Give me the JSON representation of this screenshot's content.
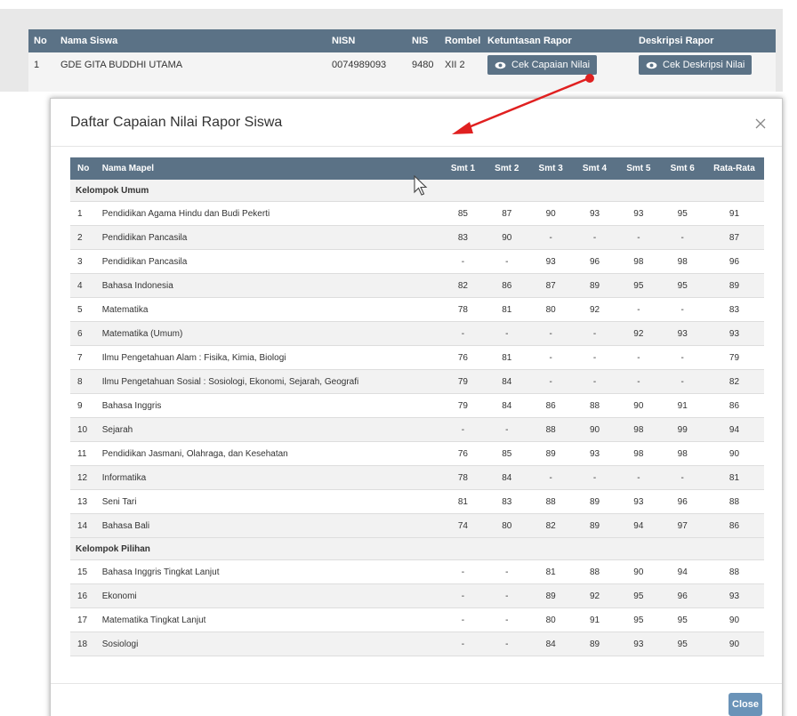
{
  "background": {
    "headers": [
      "No",
      "Nama Siswa",
      "NISN",
      "NIS",
      "Rombel",
      "Ketuntasan Rapor",
      "Deskripsi Rapor"
    ],
    "row": {
      "no": "1",
      "nama": "GDE GITA BUDDHI UTAMA",
      "nisn": "0074989093",
      "nis": "9480",
      "rombel": "XII 2",
      "cek_capaian": "Cek Capaian Nilai",
      "cek_deskripsi": "Cek Deskripsi Nilai"
    }
  },
  "modal": {
    "title": "Daftar Capaian Nilai Rapor Siswa",
    "close_label": "Close",
    "headers": {
      "no": "No",
      "mapel": "Nama Mapel",
      "smt1": "Smt 1",
      "smt2": "Smt 2",
      "smt3": "Smt 3",
      "smt4": "Smt 4",
      "smt5": "Smt 5",
      "smt6": "Smt 6",
      "rata": "Rata-Rata"
    },
    "group_umum": "Kelompok Umum",
    "group_pilihan": "Kelompok Pilihan",
    "rows_umum": [
      {
        "no": "1",
        "mapel": "Pendidikan Agama Hindu dan Budi Pekerti",
        "s": [
          "85",
          "87",
          "90",
          "93",
          "93",
          "95"
        ],
        "rata": "91"
      },
      {
        "no": "2",
        "mapel": "Pendidikan Pancasila",
        "s": [
          "83",
          "90",
          "-",
          "-",
          "-",
          "-"
        ],
        "rata": "87"
      },
      {
        "no": "3",
        "mapel": "Pendidikan Pancasila",
        "s": [
          "-",
          "-",
          "93",
          "96",
          "98",
          "98"
        ],
        "rata": "96"
      },
      {
        "no": "4",
        "mapel": "Bahasa Indonesia",
        "s": [
          "82",
          "86",
          "87",
          "89",
          "95",
          "95"
        ],
        "rata": "89"
      },
      {
        "no": "5",
        "mapel": "Matematika",
        "s": [
          "78",
          "81",
          "80",
          "92",
          "-",
          "-"
        ],
        "rata": "83"
      },
      {
        "no": "6",
        "mapel": "Matematika (Umum)",
        "s": [
          "-",
          "-",
          "-",
          "-",
          "92",
          "93"
        ],
        "rata": "93"
      },
      {
        "no": "7",
        "mapel": "Ilmu Pengetahuan Alam : Fisika, Kimia, Biologi",
        "s": [
          "76",
          "81",
          "-",
          "-",
          "-",
          "-"
        ],
        "rata": "79"
      },
      {
        "no": "8",
        "mapel": "Ilmu Pengetahuan Sosial : Sosiologi, Ekonomi, Sejarah, Geografi",
        "s": [
          "79",
          "84",
          "-",
          "-",
          "-",
          "-"
        ],
        "rata": "82"
      },
      {
        "no": "9",
        "mapel": "Bahasa Inggris",
        "s": [
          "79",
          "84",
          "86",
          "88",
          "90",
          "91"
        ],
        "rata": "86"
      },
      {
        "no": "10",
        "mapel": "Sejarah",
        "s": [
          "-",
          "-",
          "88",
          "90",
          "98",
          "99"
        ],
        "rata": "94"
      },
      {
        "no": "11",
        "mapel": "Pendidikan Jasmani, Olahraga, dan Kesehatan",
        "s": [
          "76",
          "85",
          "89",
          "93",
          "98",
          "98"
        ],
        "rata": "90"
      },
      {
        "no": "12",
        "mapel": "Informatika",
        "s": [
          "78",
          "84",
          "-",
          "-",
          "-",
          "-"
        ],
        "rata": "81"
      },
      {
        "no": "13",
        "mapel": "Seni Tari",
        "s": [
          "81",
          "83",
          "88",
          "89",
          "93",
          "96"
        ],
        "rata": "88"
      },
      {
        "no": "14",
        "mapel": "Bahasa Bali",
        "s": [
          "74",
          "80",
          "82",
          "89",
          "94",
          "97"
        ],
        "rata": "86"
      }
    ],
    "rows_pilihan": [
      {
        "no": "15",
        "mapel": "Bahasa Inggris Tingkat Lanjut",
        "s": [
          "-",
          "-",
          "81",
          "88",
          "90",
          "94"
        ],
        "rata": "88"
      },
      {
        "no": "16",
        "mapel": "Ekonomi",
        "s": [
          "-",
          "-",
          "89",
          "92",
          "95",
          "96"
        ],
        "rata": "93"
      },
      {
        "no": "17",
        "mapel": "Matematika Tingkat Lanjut",
        "s": [
          "-",
          "-",
          "80",
          "91",
          "95",
          "95"
        ],
        "rata": "90"
      },
      {
        "no": "18",
        "mapel": "Sosiologi",
        "s": [
          "-",
          "-",
          "84",
          "89",
          "93",
          "95"
        ],
        "rata": "90"
      }
    ]
  },
  "colors": {
    "table_header": "#5b7286",
    "close_button": "#6a93b8",
    "annotation_arrow": "#e02020"
  },
  "icons": {
    "eye": "eye-icon",
    "close": "close-icon",
    "cursor": "mouse-pointer-icon"
  }
}
